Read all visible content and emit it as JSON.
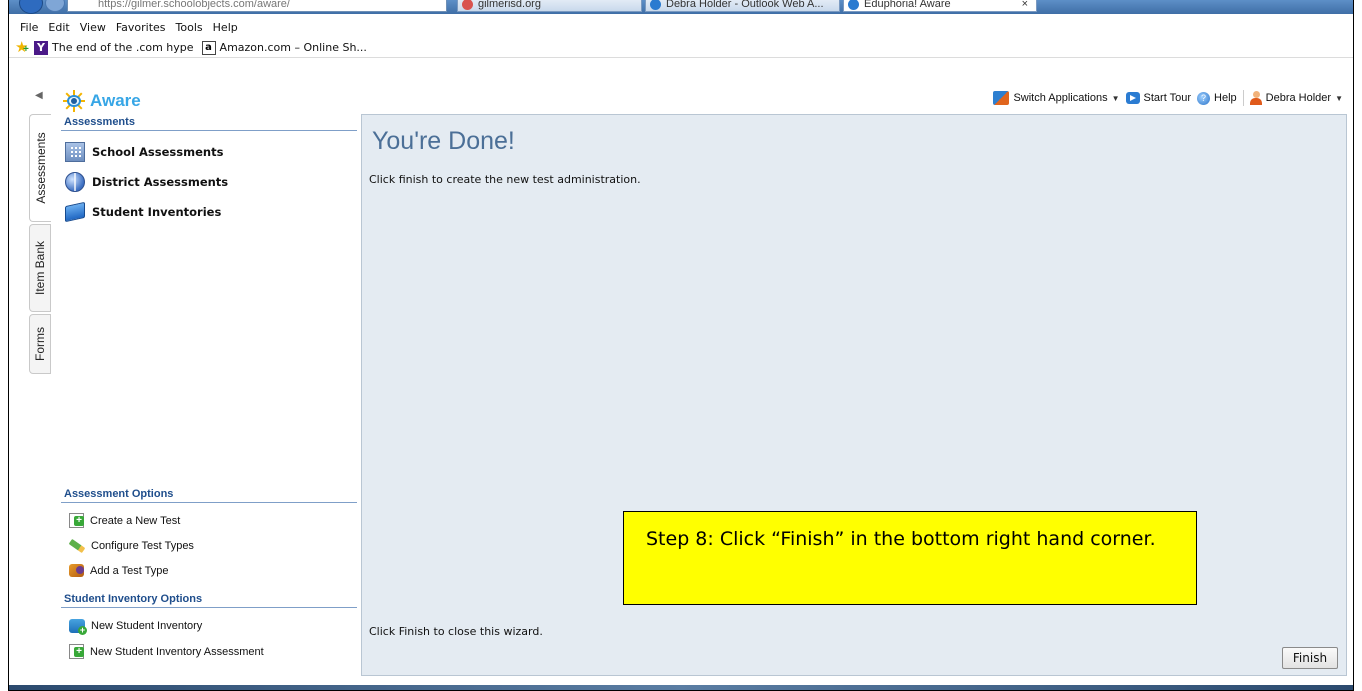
{
  "browser": {
    "address": "https://gilmer.schoolobjects.com/aware/",
    "tabs": [
      {
        "label": "gilmerisd.org",
        "favicon_color": "#d9534f"
      },
      {
        "label": "Debra Holder - Outlook Web A...",
        "favicon_color": "#2b7bd0"
      },
      {
        "label": "Eduphoria! Aware",
        "favicon_color": "#2b7bd0",
        "active": true,
        "close": "×"
      }
    ]
  },
  "menu": [
    "File",
    "Edit",
    "View",
    "Favorites",
    "Tools",
    "Help"
  ],
  "favorites": [
    {
      "icon": "y-icon",
      "label": "The end of the .com hype"
    },
    {
      "icon": "a-icon",
      "label": "Amazon.com – Online Sh..."
    }
  ],
  "app": {
    "logo_text": "Aware",
    "collapse_arrow": "◀",
    "accent_color": "#37a6e6",
    "header_actions": {
      "switch_label": "Switch Applications",
      "tour_label": "Start Tour",
      "help_label": "Help",
      "user_label": "Debra Holder",
      "caret": "▼"
    }
  },
  "vertical_tabs": [
    "Assessments",
    "Item Bank",
    "Forms"
  ],
  "sidebar": {
    "assessments_head": "Assessments",
    "items": [
      {
        "icon": "building-icon",
        "label": "School Assessments"
      },
      {
        "icon": "globe-icon",
        "label": "District Assessments"
      },
      {
        "icon": "book-icon",
        "label": "Student Inventories"
      }
    ],
    "options_head": "Assessment Options",
    "options": [
      {
        "icon": "doc-add-icon",
        "label": "Create a New Test"
      },
      {
        "icon": "pencil-icon",
        "label": "Configure Test Types"
      },
      {
        "icon": "addtype-icon",
        "label": "Add a Test Type"
      }
    ],
    "inventory_head": "Student Inventory Options",
    "inventory_options": [
      {
        "icon": "inv-add-icon",
        "label": "New Student Inventory"
      },
      {
        "icon": "doc-add-icon",
        "label": "New Student Inventory Assessment"
      }
    ]
  },
  "main": {
    "title": "You're Done!",
    "description": "Click finish to create the new test administration.",
    "close_text": "Click Finish to close this wizard.",
    "finish_label": "Finish",
    "background": "#e4ebf2"
  },
  "callout": {
    "text": "Step 8: Click “Finish” in the bottom right hand corner.",
    "color": "#ffff00"
  }
}
